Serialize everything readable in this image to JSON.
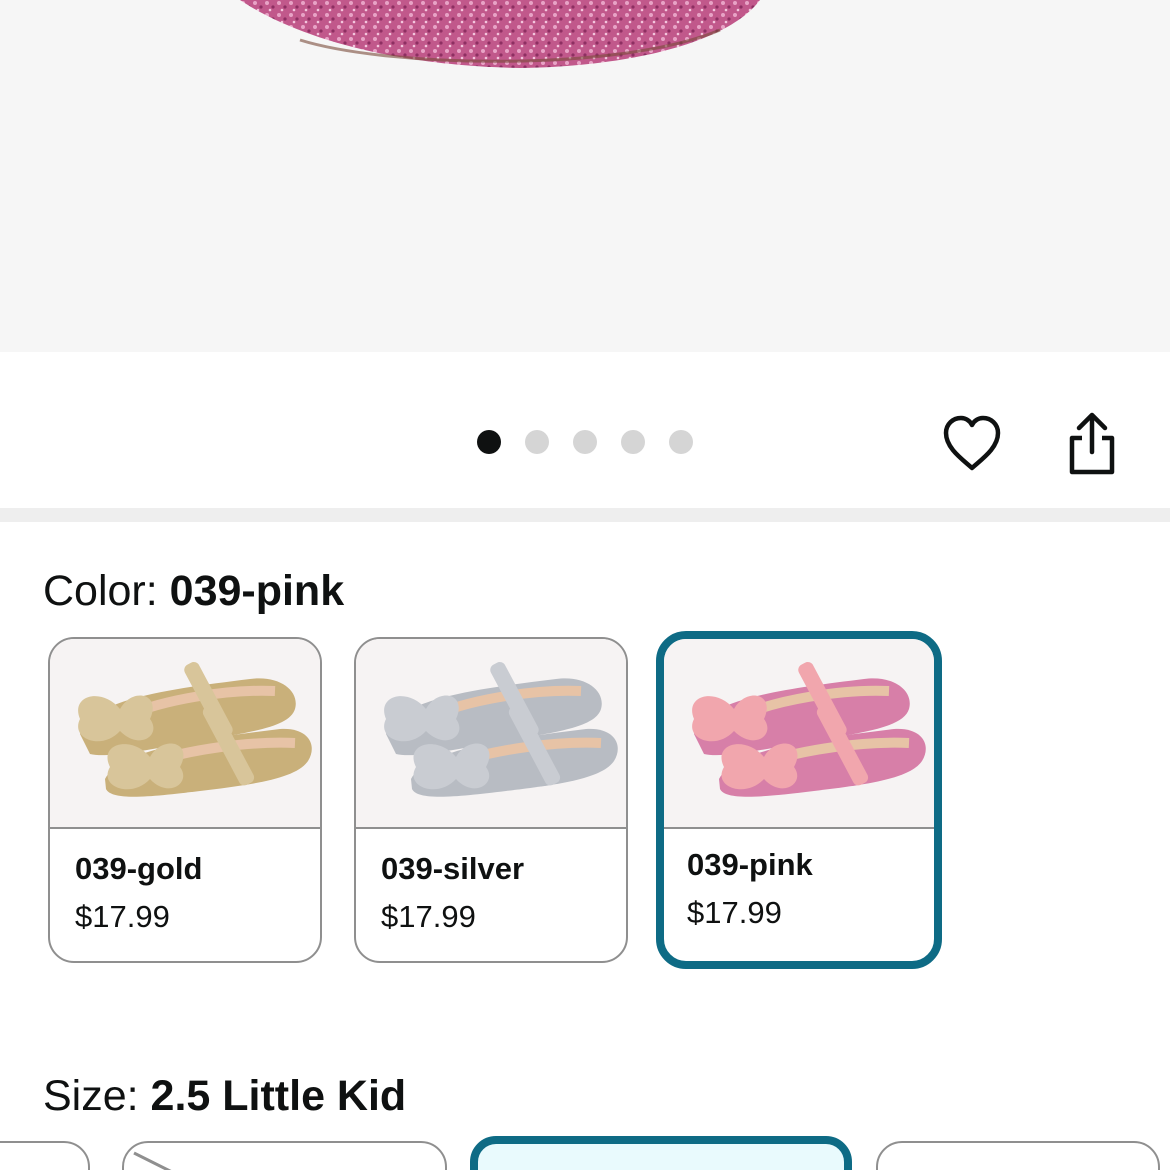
{
  "gallery": {
    "image_name": "pink glitter shoe product image",
    "dots": [
      {
        "active": true
      },
      {
        "active": false
      },
      {
        "active": false
      },
      {
        "active": false
      },
      {
        "active": false
      }
    ],
    "favorite_icon": "heart-icon",
    "share_icon": "share-icon"
  },
  "color": {
    "label": "Color: ",
    "value": "039-pink",
    "options": [
      {
        "name": "039-gold",
        "price": "$17.99",
        "shoe_color": "#c9b07a",
        "bow_color": "#d8c59a",
        "selected": false
      },
      {
        "name": "039-silver",
        "price": "$17.99",
        "shoe_color": "#b8bcc3",
        "bow_color": "#c9ccd2",
        "selected": false
      },
      {
        "name": "039-pink",
        "price": "$17.99",
        "shoe_color": "#d77fa8",
        "bow_color": "#f1a6ad",
        "selected": true
      }
    ]
  },
  "size": {
    "label": "Size: ",
    "value": "2.5 Little Kid"
  },
  "colors": {
    "accent": "#0e6b85",
    "selected_size_bg": "#e9fafd"
  }
}
